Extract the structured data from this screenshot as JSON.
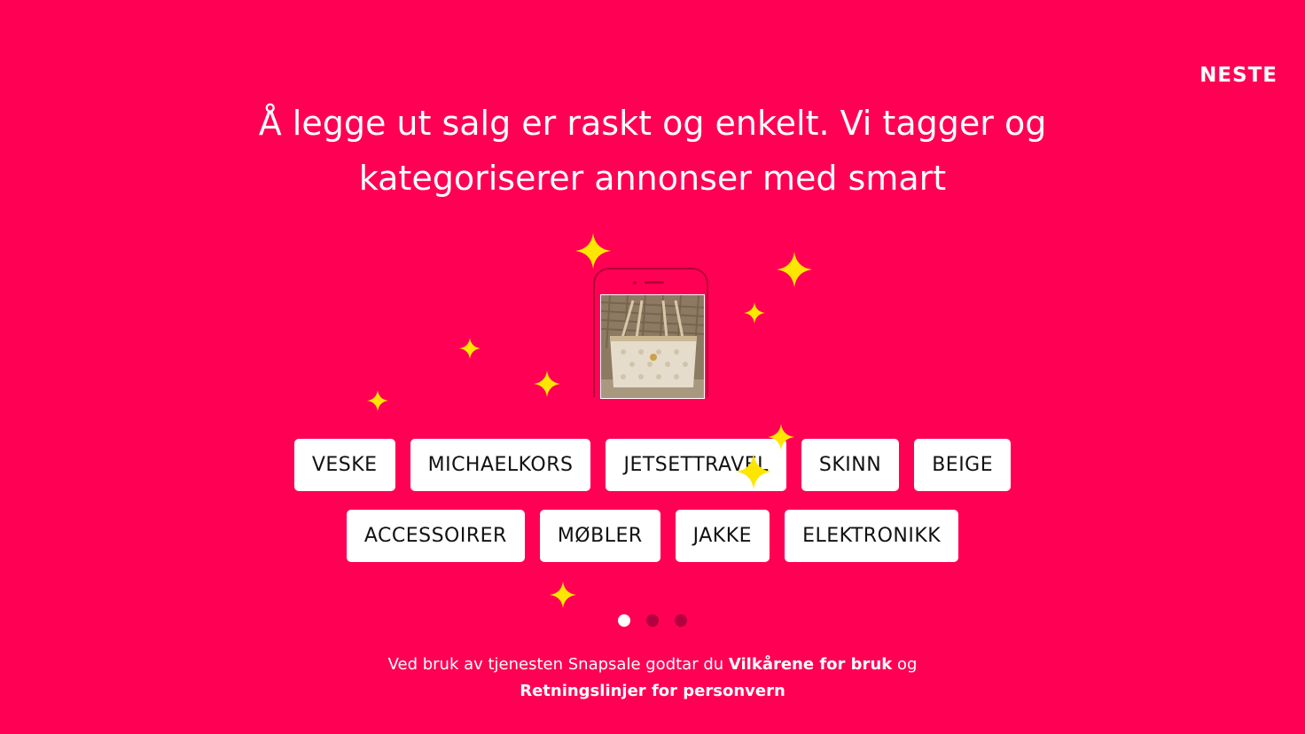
{
  "header": {
    "next_label": "NESTE"
  },
  "headline": {
    "line1": "Å legge ut salg er raskt og enkelt. Vi tagger og",
    "line2": "kategoriserer annonser med smart"
  },
  "illustration": {
    "phone_icon": "phone-icon",
    "photo_icon": "handbag-photo",
    "sparkle_icon": "sparkle-icon"
  },
  "tags": {
    "row1": [
      "VESKE",
      "MICHAELKORS",
      "JETSETTRAVEL",
      "SKINN",
      "BEIGE"
    ],
    "row2": [
      "ACCESSOIRER",
      "MØBLER",
      "JAKKE",
      "ELEKTRONIKK"
    ]
  },
  "pagination": {
    "total": 3,
    "active_index": 0
  },
  "footer": {
    "prefix": "Ved bruk av tjenesten Snapsale godtar du ",
    "terms_link": "Vilkårene for bruk",
    "middle": " og ",
    "privacy_link": "Retningslinjer for personvern"
  },
  "colors": {
    "background": "#FF0055",
    "sparkle": "#FFE600",
    "tag_bg": "#FFFFFF",
    "dot_inactive": "#B30040",
    "dot_active": "#FFFFFF"
  }
}
